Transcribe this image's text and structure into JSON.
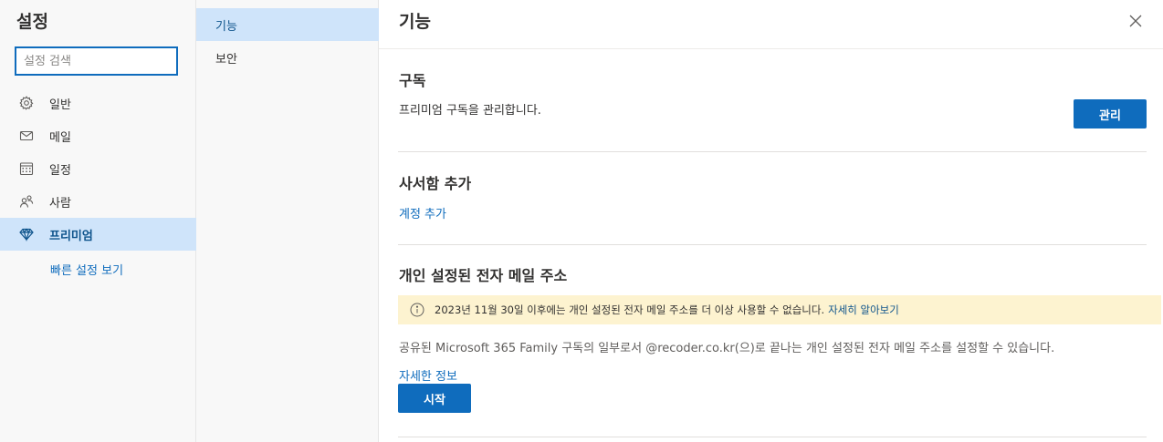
{
  "left_nav": {
    "title": "설정",
    "search": {
      "placeholder": "설정 검색",
      "value": ""
    },
    "items": [
      {
        "label": "일반",
        "icon": "gear-icon"
      },
      {
        "label": "메일",
        "icon": "mail-icon"
      },
      {
        "label": "일정",
        "icon": "calendar-icon"
      },
      {
        "label": "사람",
        "icon": "people-icon"
      },
      {
        "label": "프리미엄",
        "icon": "diamond-icon",
        "active": true
      }
    ],
    "quick_settings_link": "빠른 설정 보기"
  },
  "mid_nav": {
    "items": [
      {
        "label": "기능",
        "active": true
      },
      {
        "label": "보안"
      }
    ]
  },
  "main": {
    "title": "기능",
    "subscription": {
      "title": "구독",
      "description": "프리미엄 구독을 관리합니다.",
      "button": "관리"
    },
    "mailbox": {
      "title": "사서함 추가",
      "link": "계정 추가"
    },
    "personal_email": {
      "title": "개인 설정된 전자 메일 주소",
      "notice_text": "2023년 11월 30일 이후에는 개인 설정된 전자 메일 주소를 더 이상 사용할 수 없습니다.",
      "notice_link": "자세히 알아보기",
      "description": "공유된 Microsoft 365 Family 구독의 일부로서 @recoder.co.kr(으)로 끝나는 개인 설정된 전자 메일 주소를 설정할 수 있습니다.",
      "more_link": "자세한 정보",
      "start_button": "시작"
    }
  },
  "colors": {
    "accent": "#0f6cbd",
    "selected_bg": "#cfe4fa",
    "notice_bg": "#fdf3d0"
  }
}
